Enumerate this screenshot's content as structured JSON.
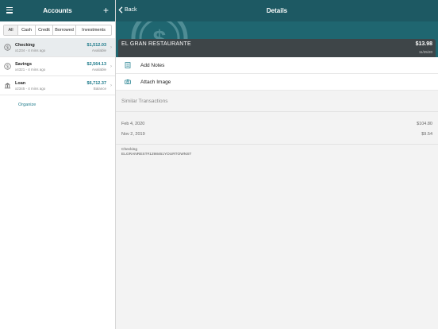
{
  "sidebar": {
    "title": "Accounts",
    "filters": [
      "All",
      "Cash",
      "Credit",
      "Borrowed",
      "Investments"
    ],
    "accounts": [
      {
        "name": "Checking",
        "sub": "x1234 - 4 mins ago",
        "amount": "$1,512.03",
        "label": "Available"
      },
      {
        "name": "Savings",
        "sub": "x4321 - 4 mins ago",
        "amount": "$2,564.13",
        "label": "Available"
      },
      {
        "name": "Loan",
        "sub": "x2345 - 4 mins ago",
        "amount": "$6,712.37",
        "label": "Balance"
      }
    ],
    "organize": "Organize"
  },
  "details": {
    "back_label": "Back",
    "title": "Details",
    "merchant": "EL GRAN RESTAURANTE",
    "amount": "$13.98",
    "date": "11/25/20",
    "actions": [
      "Add Notes",
      "Attach Image"
    ],
    "similar_title": "Similar Transactions",
    "similar": [
      {
        "date": "Feb 4, 2020",
        "amount": "$104.80"
      },
      {
        "date": "Nov 2, 2019",
        "amount": "$9.54"
      }
    ],
    "account": "Checking",
    "description": "ELGRANREST#1298461YOURTOWNST"
  },
  "colors": {
    "header": "#1d5963",
    "accent": "#1d7a8a",
    "card": "#3e4548"
  }
}
